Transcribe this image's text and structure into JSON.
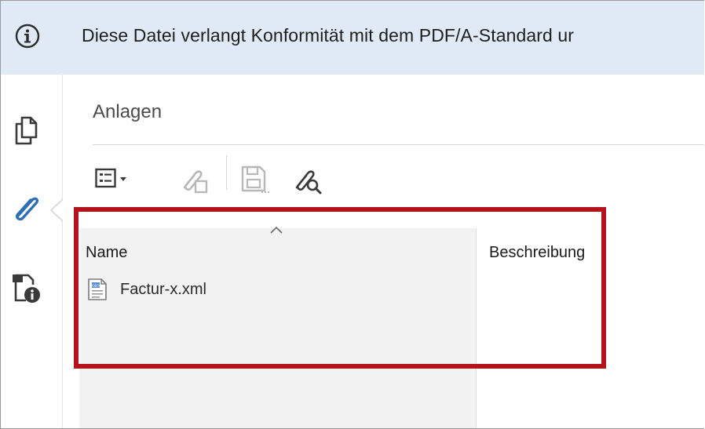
{
  "infobar": {
    "icon": "info-circle-icon",
    "message": "Diese Datei verlangt Konformität mit dem PDF/A-Standard ur"
  },
  "rail": {
    "items": [
      {
        "icon": "pages-icon"
      },
      {
        "icon": "paperclip-icon"
      },
      {
        "icon": "document-info-icon"
      }
    ]
  },
  "panel": {
    "title": "Anlagen",
    "toolbar": {
      "options": "list-options-icon",
      "add": "add-attachment-icon",
      "save": "save-attachment-icon",
      "search": "search-attachment-icon"
    },
    "table": {
      "columns": [
        "Name",
        "Beschreibung"
      ],
      "rows": [
        {
          "name": "Factur-x.xml",
          "icon": "xml-file-icon"
        }
      ]
    }
  },
  "colors": {
    "infobar_bg": "#dfeaf6",
    "accent_blue": "#2d6fb7",
    "highlight_red": "#b3141c"
  }
}
